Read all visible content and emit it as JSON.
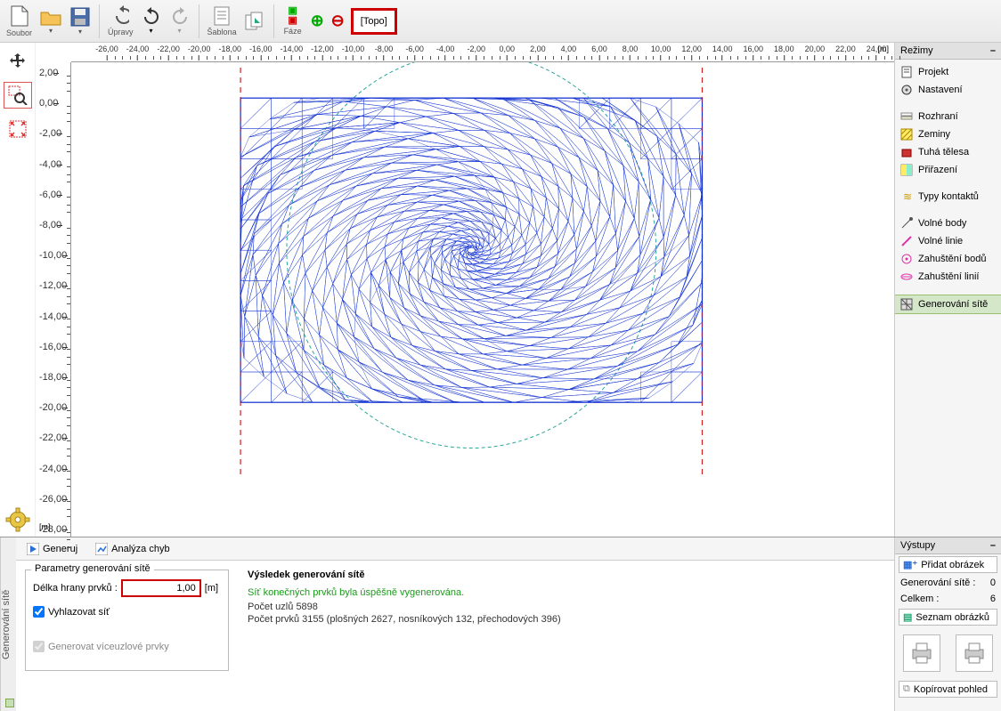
{
  "toolbar": {
    "soubor": "Soubor",
    "upravy": "Úpravy",
    "sablona": "Šablona",
    "faze": "Fáze",
    "stage_button": "[Topo]"
  },
  "ruler": {
    "h_ticks": [
      -26,
      -24,
      -22,
      -20,
      -18,
      -16,
      -14,
      -12,
      -10,
      -8,
      -6,
      -4,
      -2,
      0,
      2,
      4,
      6,
      8,
      10,
      12,
      14,
      16,
      18,
      20,
      22,
      24
    ],
    "h_unit": "[m]",
    "v_ticks": [
      2,
      0,
      -2,
      -4,
      -6,
      -8,
      -10,
      -12,
      -14,
      -16,
      -18,
      -20,
      -22,
      -24,
      -26,
      -28
    ],
    "v_unit": "[m]"
  },
  "right": {
    "title": "Režimy",
    "groups": [
      [
        {
          "label": "Projekt",
          "icon": "file"
        },
        {
          "label": "Nastavení",
          "icon": "gear"
        }
      ],
      [
        {
          "label": "Rozhraní",
          "icon": "layers"
        },
        {
          "label": "Zeminy",
          "icon": "hatch"
        },
        {
          "label": "Tuhá tělesa",
          "icon": "solid"
        },
        {
          "label": "Přiřazení",
          "icon": "assign"
        }
      ],
      [
        {
          "label": "Typy kontaktů",
          "icon": "contact"
        }
      ],
      [
        {
          "label": "Volné body",
          "icon": "point"
        },
        {
          "label": "Volné linie",
          "icon": "line"
        },
        {
          "label": "Zahuštění bodů",
          "icon": "densp"
        },
        {
          "label": "Zahuštění linií",
          "icon": "densl"
        }
      ],
      [
        {
          "label": "Generování sítě",
          "icon": "mesh",
          "active": true
        }
      ]
    ]
  },
  "bottom": {
    "sidelabel": "Generování sítě",
    "tab_generate": "Generuj",
    "tab_analyze": "Analýza chyb",
    "params_title": "Parametry generování sítě",
    "edge_label": "Délka hrany prvků :",
    "edge_value": "1,00",
    "edge_unit": "[m]",
    "smooth": "Vyhlazovat síť",
    "multinode": "Generovat víceuzlové prvky",
    "result_title": "Výsledek generování sítě",
    "ok_msg": "Síť konečných prvků byla úspěšně vygenerována.",
    "stat1_label": "Počet uzlů",
    "stat1_value": "5898",
    "stat2": "Počet prvků 3155 (plošných 2627, nosníkových 132, přechodových 396)"
  },
  "outputs": {
    "title": "Výstupy",
    "add_pic": "Přidat obrázek",
    "gen_label": "Generování sítě :",
    "gen_count": "0",
    "total_label": "Celkem :",
    "total_count": "6",
    "piclist": "Seznam obrázků",
    "copy": "Kopírovat pohled"
  }
}
